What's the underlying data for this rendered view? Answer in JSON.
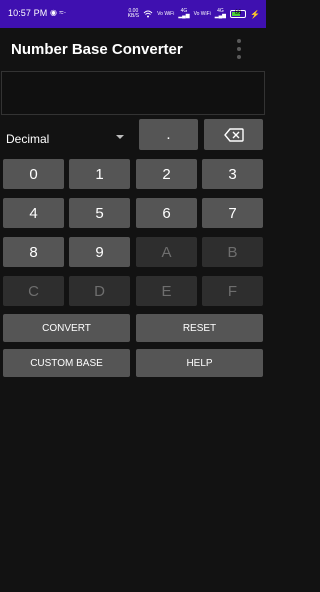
{
  "status_bar": {
    "time": "10:57 PM",
    "left_icons": "◉ ≈·",
    "net_speed_value": "0.00",
    "net_speed_unit": "KB/S",
    "sim1": "Vo WiFi",
    "sim1_net": "4G",
    "sim2": "Vo WiFi",
    "sim2_net": "4G",
    "battery": "66",
    "colors": {
      "background": "#3f10b0",
      "battery": "#4cd137"
    }
  },
  "app_bar": {
    "title": "Number Base Converter",
    "menu_icon": "more-vert-icon"
  },
  "display": {
    "value": ""
  },
  "base_select": {
    "selected": "Decimal"
  },
  "keys": {
    "dot": ".",
    "backspace_icon": "backspace-icon",
    "k0": "0",
    "k1": "1",
    "k2": "2",
    "k3": "3",
    "k4": "4",
    "k5": "5",
    "k6": "6",
    "k7": "7",
    "k8": "8",
    "k9": "9",
    "kA": "A",
    "kB": "B",
    "kC": "C",
    "kD": "D",
    "kE": "E",
    "kF": "F"
  },
  "actions": {
    "convert": "CONVERT",
    "reset": "RESET",
    "custom_base": "CUSTOM BASE",
    "help": "HELP"
  }
}
